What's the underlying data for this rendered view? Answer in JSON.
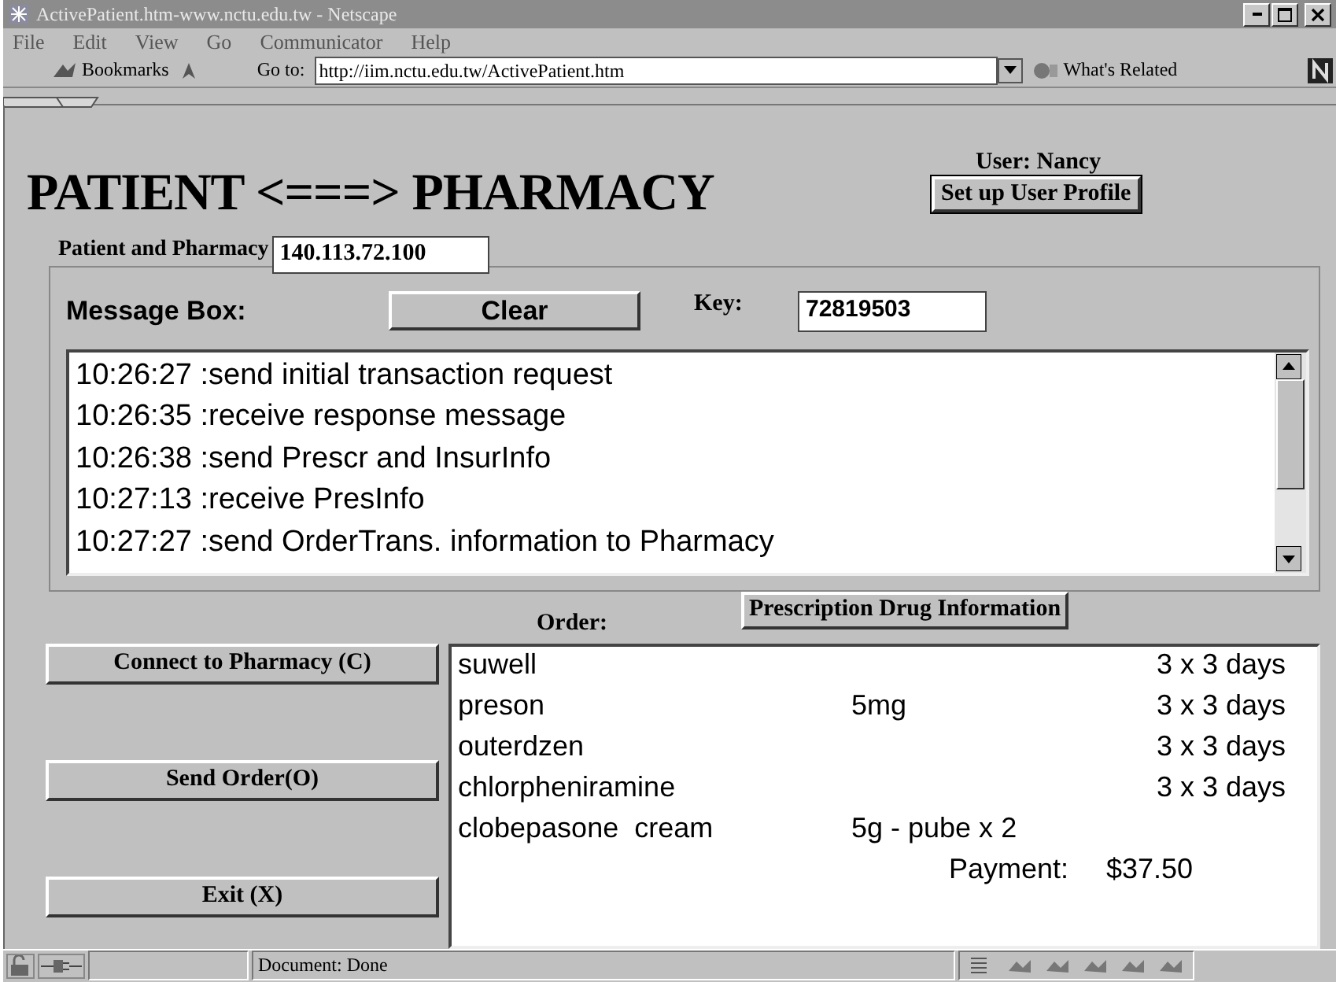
{
  "window": {
    "title": "ActivePatient.htm-www.nctu.edu.tw - Netscape"
  },
  "menu": [
    "File",
    "Edit",
    "View",
    "Go",
    "Communicator",
    "Help"
  ],
  "toolbar": {
    "bookmarks": "Bookmarks",
    "goto_label": "Go to:",
    "url": "http://iim.nctu.edu.tw/ActivePatient.htm",
    "related": "What's Related"
  },
  "page": {
    "heading": "PATIENT <===> PHARMACY",
    "user": "User: Nancy",
    "profile_button": "Set up User Profile",
    "group_label": "Patient and Pharmacy",
    "ip": "140.113.72.100",
    "message_label": "Message Box:",
    "clear_button": "Clear",
    "key_label": "Key:",
    "key": "72819503",
    "messages": [
      "10:26:27 :send initial transaction request",
      "10:26:35 :receive response message",
      "10:26:38 :send Prescr and InsurInfo",
      "10:27:13 :receive PresInfo",
      "10:27:27 :send OrderTrans. information to Pharmacy"
    ],
    "order_label": "Order:",
    "drug_info_button": "Prescription Drug Information",
    "actions": [
      {
        "label": "Connect to Pharmacy (**C**)"
      },
      {
        "label": "Send Order(**O**)"
      },
      {
        "label": "Exit (**X**)"
      }
    ],
    "order_rows": [
      {
        "name": "suwell",
        "dose": "3 x 3 days"
      },
      {
        "name": "preson",
        "amount": "5mg",
        "dose": "3 x 3 days"
      },
      {
        "name": "outerdzen",
        "dose": "3 x 3 days"
      },
      {
        "name": "chlorpheniramine",
        "dose": "3 x 3 days"
      },
      {
        "name": "clobepasone  cream",
        "amount": "5g - pube x 2"
      }
    ],
    "payment_label": "Payment:",
    "payment": "$37.50"
  },
  "status_bar": {
    "text": "Document: Done"
  }
}
